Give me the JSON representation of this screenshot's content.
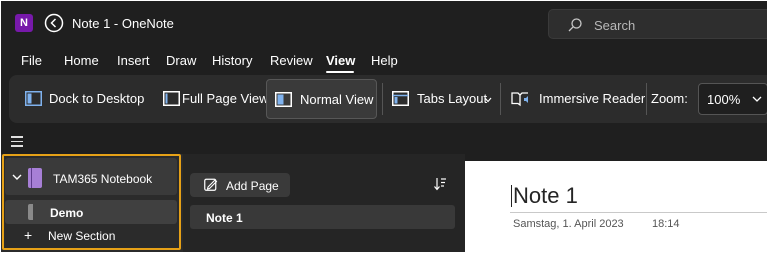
{
  "window": {
    "title": "Note 1  -  OneNote",
    "app_icon_letter": "N",
    "search_placeholder": "Search"
  },
  "menu": {
    "items": [
      "File",
      "Home",
      "Insert",
      "Draw",
      "History",
      "Review",
      "View",
      "Help"
    ],
    "active": "View"
  },
  "ribbon": {
    "dock_label": "Dock to Desktop",
    "full_page_label": "Full Page View",
    "normal_view_label": "Normal View",
    "tabs_layout_label": "Tabs Layout",
    "immersive_reader_label": "Immersive Reader",
    "zoom_label": "Zoom:",
    "zoom_value": "100%"
  },
  "notebook": {
    "name": "TAM365 Notebook",
    "sections": [
      "Demo"
    ],
    "new_section_label": "New Section"
  },
  "pages": {
    "add_page_label": "Add Page",
    "items": [
      "Note 1"
    ]
  },
  "note": {
    "title": "Note 1",
    "date": "Samstag, 1. April 2023",
    "time": "18:14"
  },
  "colors": {
    "app_purple": "#7719aa",
    "notebook_purple": "#a77fd6",
    "highlight_outline": "#e6a117",
    "background": "#1f1f1f"
  }
}
